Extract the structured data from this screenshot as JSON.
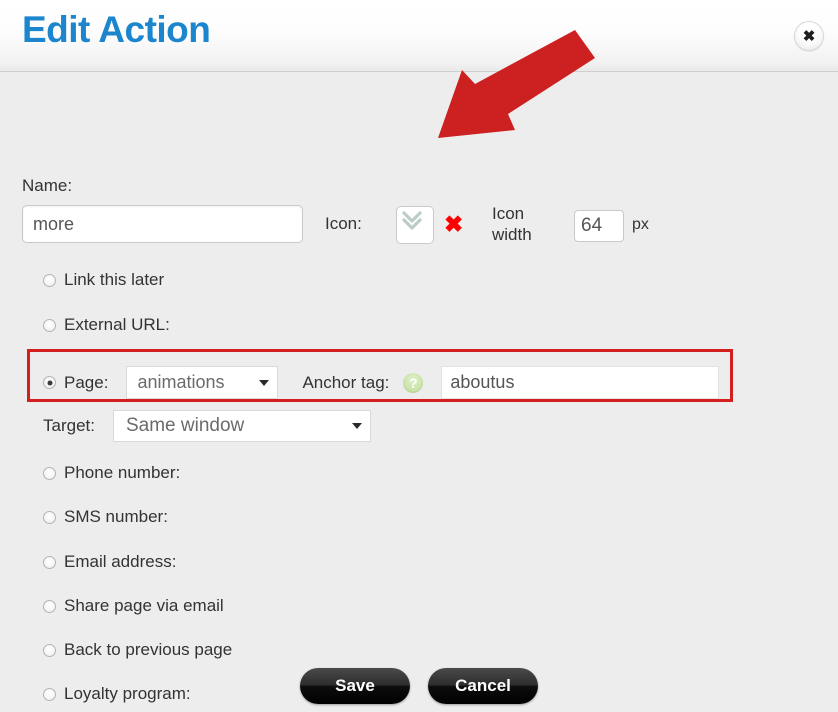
{
  "header": {
    "title": "Edit Action",
    "close_icon": "close-circle-icon",
    "title_color": "#1b86cd"
  },
  "form": {
    "name": {
      "label": "Name:",
      "value": "more",
      "placeholder": ""
    },
    "icon": {
      "label": "Icon:",
      "glyph": "double-chevron-down-icon",
      "glyph_color": "#bcd2cd",
      "delete_glyph": "✖",
      "delete_color": "#ff0000"
    },
    "icon_width": {
      "label": "Icon width",
      "value": "64",
      "unit": "px"
    },
    "options": [
      {
        "id": "link-later",
        "label": "Link this later",
        "selected": false
      },
      {
        "id": "external-url",
        "label": "External URL:",
        "selected": false
      },
      {
        "id": "page",
        "label": "Page:",
        "selected": true
      },
      {
        "id": "phone-number",
        "label": "Phone number:",
        "selected": false
      },
      {
        "id": "sms-number",
        "label": "SMS number:",
        "selected": false
      },
      {
        "id": "email-address",
        "label": "Email address:",
        "selected": false
      },
      {
        "id": "share-page-via-email",
        "label": "Share page via email",
        "selected": false
      },
      {
        "id": "back-to-previous-page",
        "label": "Back to previous page",
        "selected": false
      },
      {
        "id": "loyalty-program",
        "label": "Loyalty program:",
        "selected": false
      }
    ],
    "page_row": {
      "radio_label": "Page:",
      "page_select_value": "animations",
      "anchor_label": "Anchor tag:",
      "help_glyph": "?",
      "anchor_value": "aboutus",
      "highlight_color": "#d41f1f"
    },
    "target": {
      "label": "Target:",
      "value": "Same window"
    }
  },
  "footer": {
    "save_label": "Save",
    "cancel_label": "Cancel"
  },
  "annotation": {
    "arrow_color": "#cd2020",
    "arrow_name": "red-pointer-arrow"
  }
}
